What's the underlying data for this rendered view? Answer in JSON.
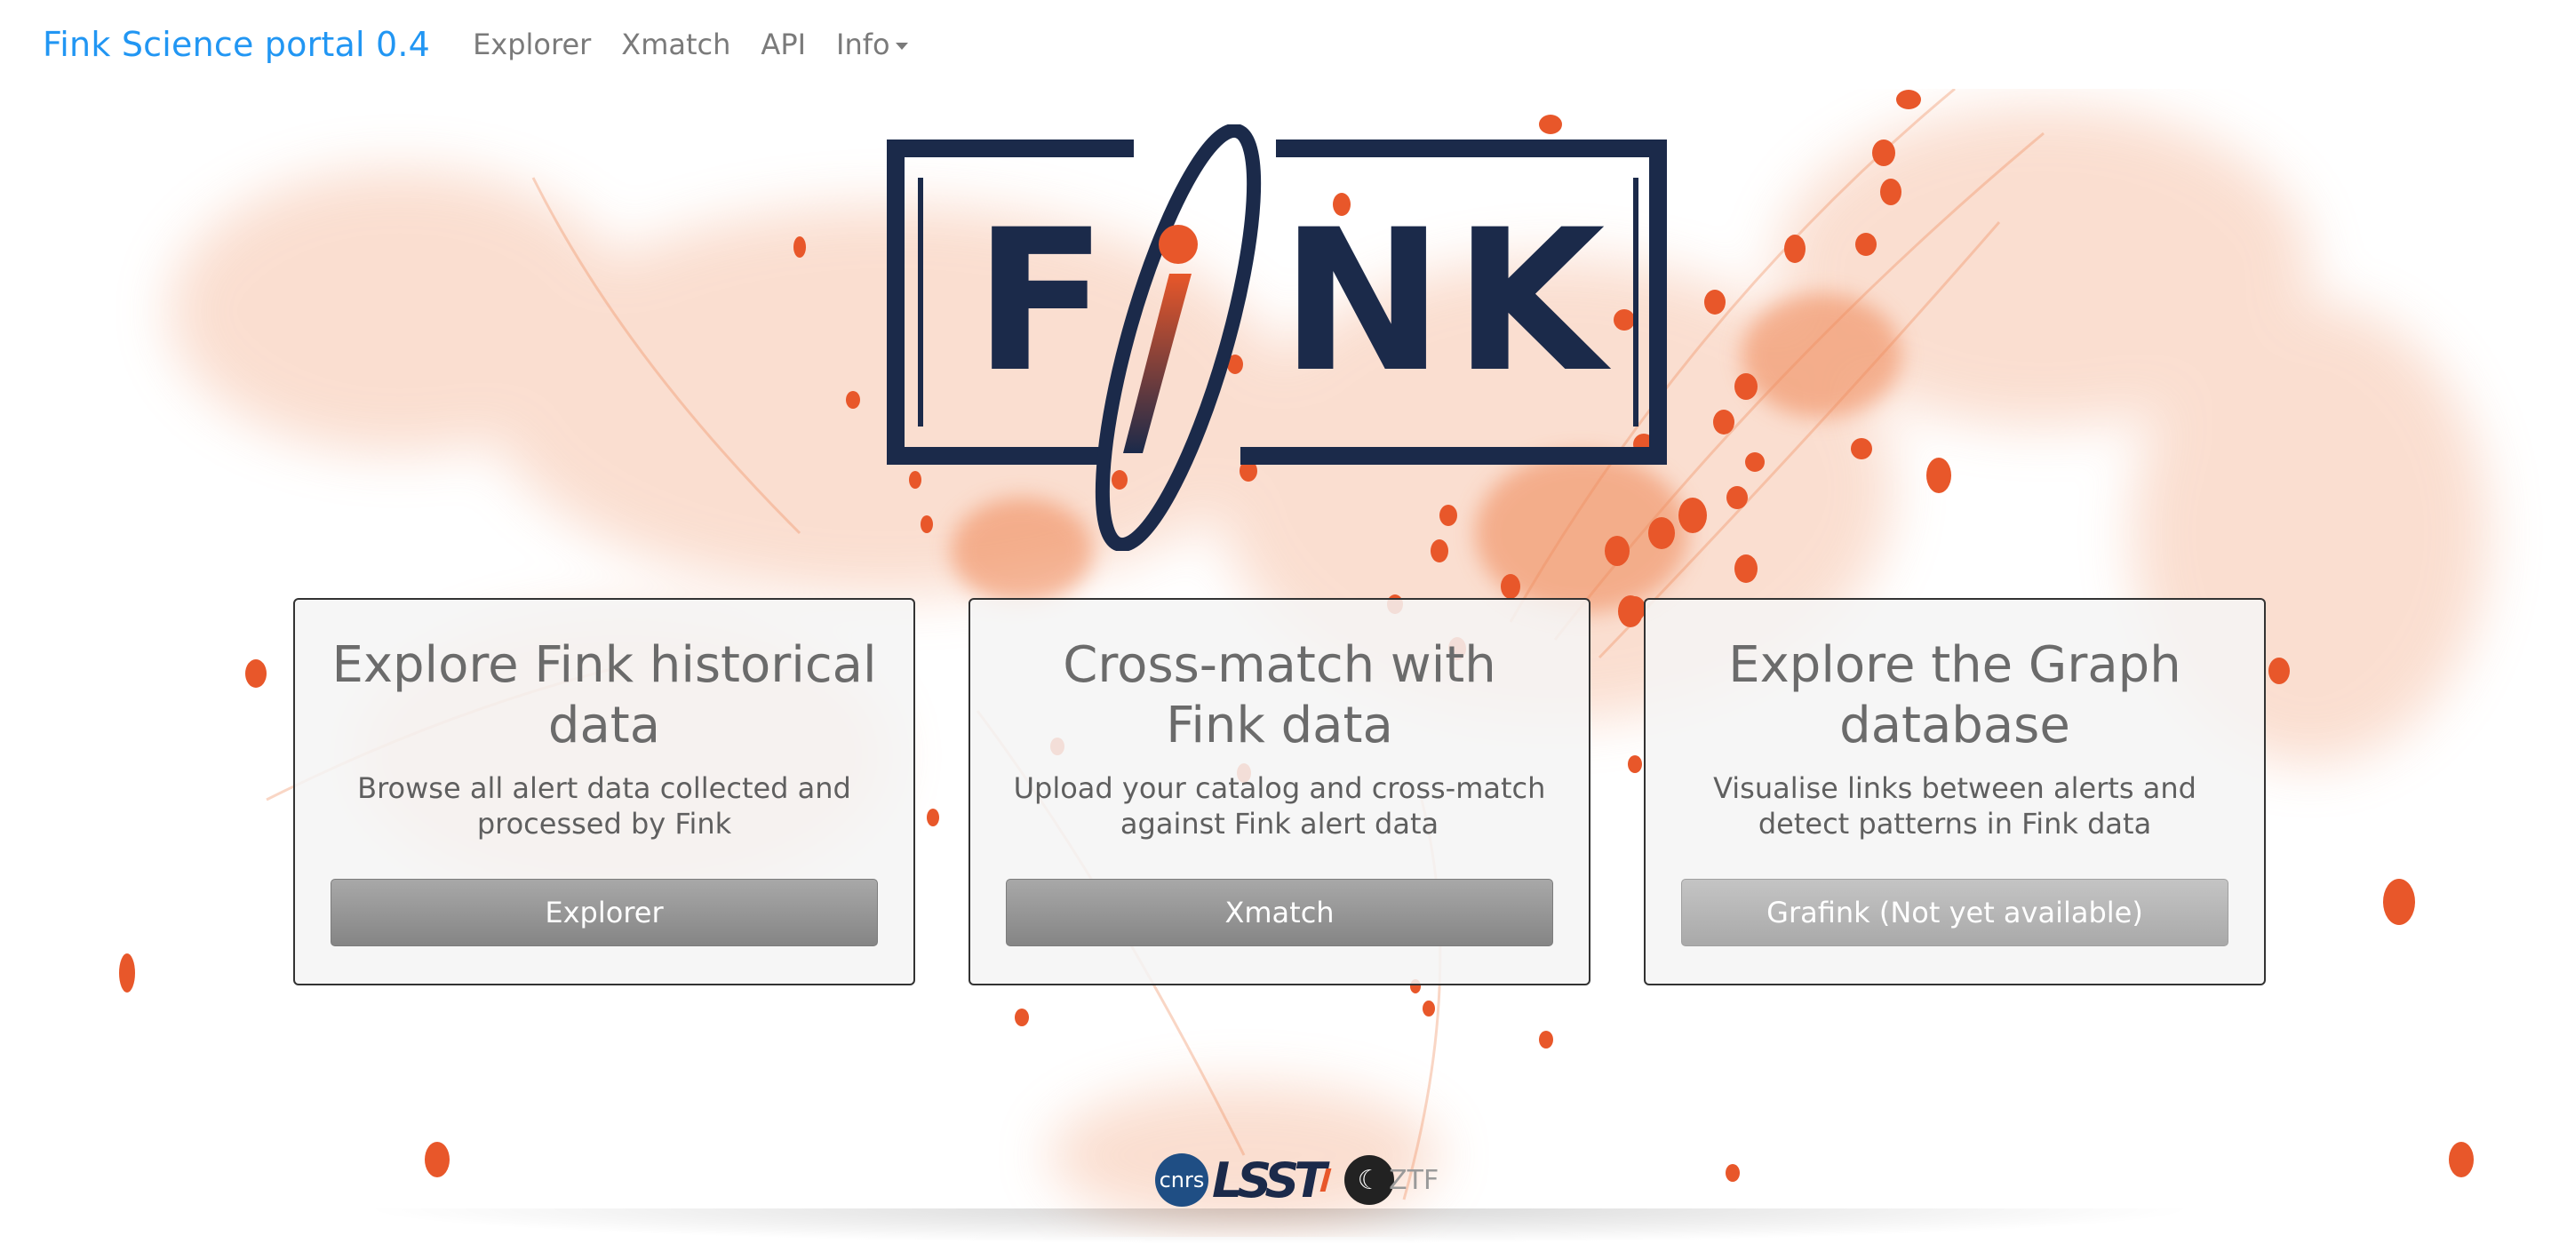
{
  "navbar": {
    "brand": "Fink Science portal 0.4",
    "links": [
      {
        "label": "Explorer"
      },
      {
        "label": "Xmatch"
      },
      {
        "label": "API"
      },
      {
        "label": "Info"
      }
    ]
  },
  "logo": {
    "text": "FINK",
    "icon": "fink-logo-icon"
  },
  "cards": [
    {
      "title": "Explore Fink historical data",
      "text": "Browse all alert data collected and processed by Fink",
      "button": "Explorer",
      "enabled": true
    },
    {
      "title": "Cross-match with Fink data",
      "text": "Upload your catalog and cross-match against Fink alert data",
      "button": "Xmatch",
      "enabled": true
    },
    {
      "title": "Explore the Graph database",
      "text": "Visualise links between alerts and detect patterns in Fink data",
      "button": "Grafink (Not yet available)",
      "enabled": false
    }
  ],
  "footer": {
    "logos": [
      {
        "name": "cnrs-logo-icon",
        "text": "cnrs"
      },
      {
        "name": "lsst-logo-icon",
        "text": "LSST"
      },
      {
        "name": "ztf-logo-icon",
        "text": "ZTF"
      }
    ]
  },
  "colors": {
    "brand": "#2196f3",
    "accent_orange": "#e8572a",
    "logo_navy": "#1b2a4a",
    "button_gray": "#8f8f8f"
  }
}
